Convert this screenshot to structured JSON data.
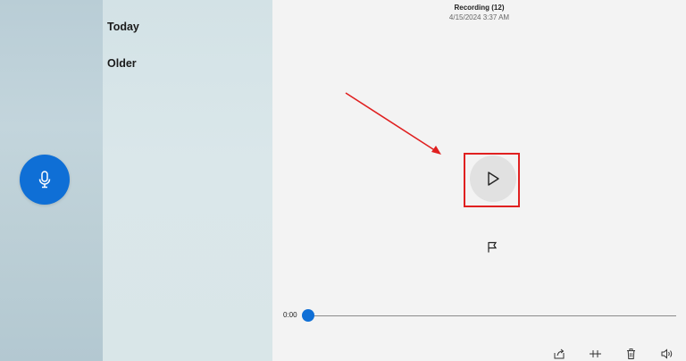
{
  "sidebar": {
    "record_button_icon": "microphone-icon",
    "accent_color": "#0f6fd6"
  },
  "list": {
    "groups": [
      {
        "label": "Today"
      },
      {
        "label": "Older"
      }
    ]
  },
  "player": {
    "title": "Recording (12)",
    "date": "4/15/2024 3:37 AM",
    "play_icon": "play-icon",
    "marker_icon": "flag-icon",
    "current_time": "0:00",
    "progress": 0
  },
  "toolbar": {
    "icons": [
      "share-icon",
      "trim-icon",
      "delete-icon",
      "speaker-icon"
    ]
  },
  "annotation": {
    "color": "#e02020"
  }
}
